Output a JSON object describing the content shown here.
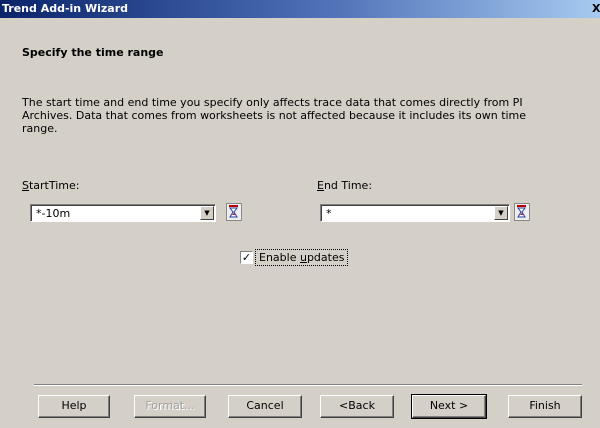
{
  "window": {
    "title": "Trend Add-in Wizard",
    "close_glyph": "X"
  },
  "page": {
    "heading": "Specify the time range",
    "description": "The start time and end time you specify only affects trace data that comes directly from PI Archives. Data that comes from worksheets is not affected because it includes its own time range."
  },
  "start_time": {
    "label_accel": "S",
    "label_rest": "tartTime:",
    "value": "*-10m"
  },
  "end_time": {
    "label_accel": "E",
    "label_rest": "nd Time:",
    "value": "*"
  },
  "enable_updates": {
    "label_pre": "Enable ",
    "label_accel": "u",
    "label_post": "pdates",
    "checked_glyph": "✓"
  },
  "buttons": {
    "help": "Help",
    "format": "Format...",
    "cancel": "Cancel",
    "back": "<Back",
    "next": "Next >",
    "finish": "Finish"
  },
  "icons": {
    "dropdown": "dropdown-arrow-icon",
    "time_picker": "time-picker-icon"
  }
}
